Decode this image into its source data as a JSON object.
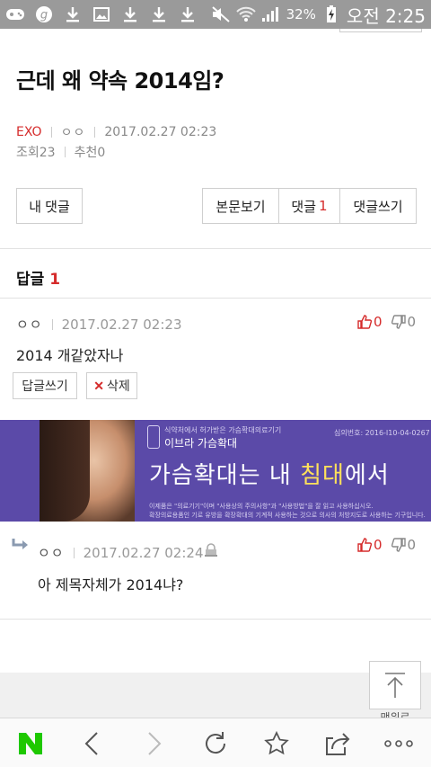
{
  "status_bar": {
    "battery": "32%",
    "time": "오전 2:25"
  },
  "post": {
    "title": "근데 왜 약속 2014임?",
    "category": "EXO",
    "author": "ㅇㅇ",
    "datetime": "2017.02.27 02:23",
    "views_label": "조회23",
    "recommend_label": "추천0"
  },
  "actions": {
    "my_comments": "내 댓글",
    "view_post": "본문보기",
    "comments_label": "댓글",
    "comments_count": "1",
    "write_comment": "댓글쓰기"
  },
  "replies_header": {
    "label": "답글",
    "count": "1"
  },
  "comment1": {
    "author": "ㅇㅇ",
    "datetime": "2017.02.27 02:23",
    "body": "2014 개같았자나",
    "up": "0",
    "down": "0",
    "reply_button": "답글쓰기",
    "delete_button": "삭제"
  },
  "ad": {
    "small_text": "식약처에서 허가받은 가슴확대의료기기",
    "brand": "이브라 가슴확대",
    "serial": "심의번호: 2016-I10-04-0267",
    "headline_a": "가슴확대는 내 ",
    "headline_b": "침대",
    "headline_c": "에서",
    "fine1": "이제품은 \"의료기기\"이며 \"사용상의 주의사항\"과 \"사용방법\"을 잘 읽고 사용하십시오.",
    "fine2": "확장의료용품인 기로 유방을 확장확대의 기계적 사용하는 것으로 의사의 처방지도로 사용하는 기구입니다."
  },
  "comment2": {
    "author": "ㅇㅇ",
    "datetime": "2017.02.27 02:24",
    "body": "아 제목자체가 2014냐?",
    "up": "0",
    "down": "0"
  },
  "floating": {
    "top_label": "맨위로"
  },
  "colors": {
    "accent_red": "#d52b2b",
    "naver_green": "#1ec800",
    "ad_purple": "#5b4aa8"
  }
}
